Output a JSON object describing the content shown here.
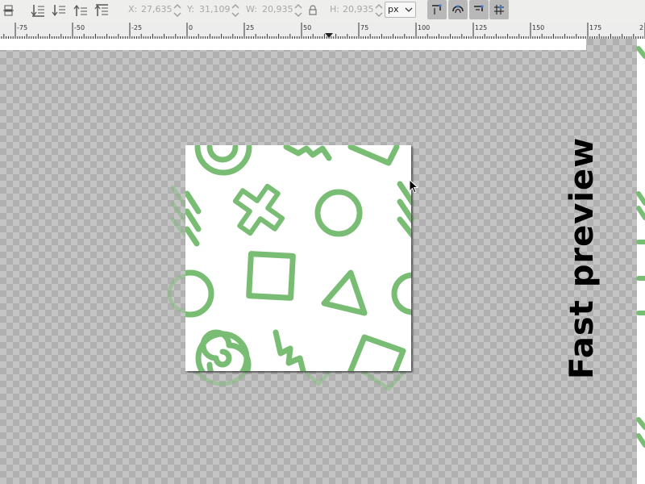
{
  "toolbar": {
    "x_label": "X:",
    "x_value": "27,635",
    "y_label": "Y:",
    "y_value": "31,109",
    "w_label": "W:",
    "w_value": "20,935",
    "h_label": "H:",
    "h_value": "20,935",
    "unit": "px",
    "icons": [
      "select-same-icon",
      "lower-to-bottom-icon",
      "lower-icon",
      "raise-icon",
      "raise-to-top-icon",
      "lock-icon",
      "snap-bbox-icon",
      "snap-path-icon",
      "snap-node-icon",
      "snap-grid-icon"
    ]
  },
  "ruler": {
    "labels": [
      "-75",
      "-50",
      "-25",
      "0",
      "25",
      "50",
      "75",
      "100",
      "125",
      "150",
      "175",
      "2"
    ]
  },
  "canvas": {
    "overlay_text": "Fast preview",
    "pattern_color": "#79bd74"
  }
}
